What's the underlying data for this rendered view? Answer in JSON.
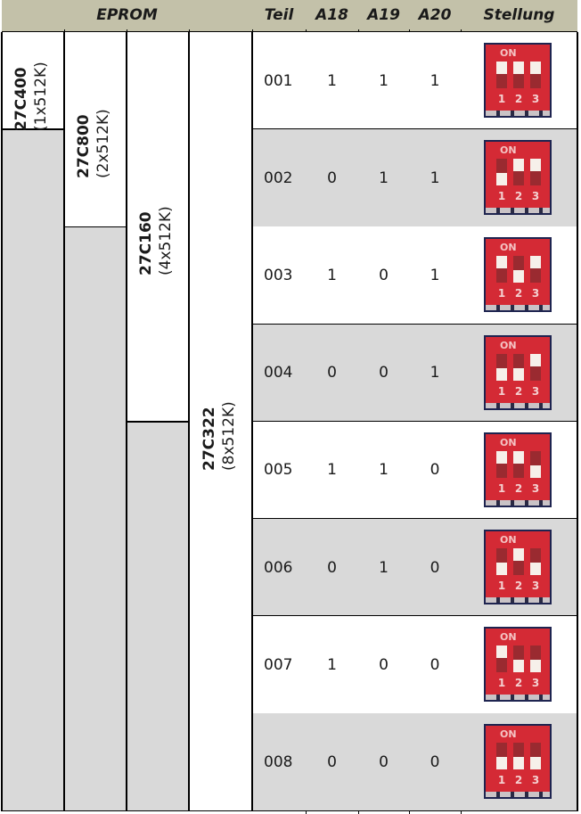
{
  "header": {
    "eprom": "EPROM",
    "teil": "Teil",
    "a18": "A18",
    "a19": "A19",
    "a20": "A20",
    "stellung": "Stellung"
  },
  "eproms": [
    {
      "chip": "27C400",
      "capacity": "(1x512K)",
      "parts": 1
    },
    {
      "chip": "27C800",
      "capacity": "(2x512K)",
      "parts": 2
    },
    {
      "chip": "27C160",
      "capacity": "(4x512K)",
      "parts": 4
    },
    {
      "chip": "27C322",
      "capacity": "(8x512K)",
      "parts": 8
    }
  ],
  "rows": [
    {
      "teil": "001",
      "a18": "1",
      "a19": "1",
      "a20": "1"
    },
    {
      "teil": "002",
      "a18": "0",
      "a19": "1",
      "a20": "1"
    },
    {
      "teil": "003",
      "a18": "1",
      "a19": "0",
      "a20": "1"
    },
    {
      "teil": "004",
      "a18": "0",
      "a19": "0",
      "a20": "1"
    },
    {
      "teil": "005",
      "a18": "1",
      "a19": "1",
      "a20": "0"
    },
    {
      "teil": "006",
      "a18": "0",
      "a19": "1",
      "a20": "0"
    },
    {
      "teil": "007",
      "a18": "1",
      "a19": "0",
      "a20": "0"
    },
    {
      "teil": "008",
      "a18": "0",
      "a19": "0",
      "a20": "0"
    }
  ],
  "dip_switch": {
    "on_label": "ON",
    "switch_numbers": [
      "1",
      "2",
      "3"
    ],
    "colors": {
      "body": "#d42a35",
      "knob": "#f6f0ea",
      "frame": "#1e2450"
    }
  },
  "colors": {
    "header_bg": "#c3c1a9",
    "shaded_cell": "#d9d9d9",
    "white_cell": "#ffffff"
  }
}
